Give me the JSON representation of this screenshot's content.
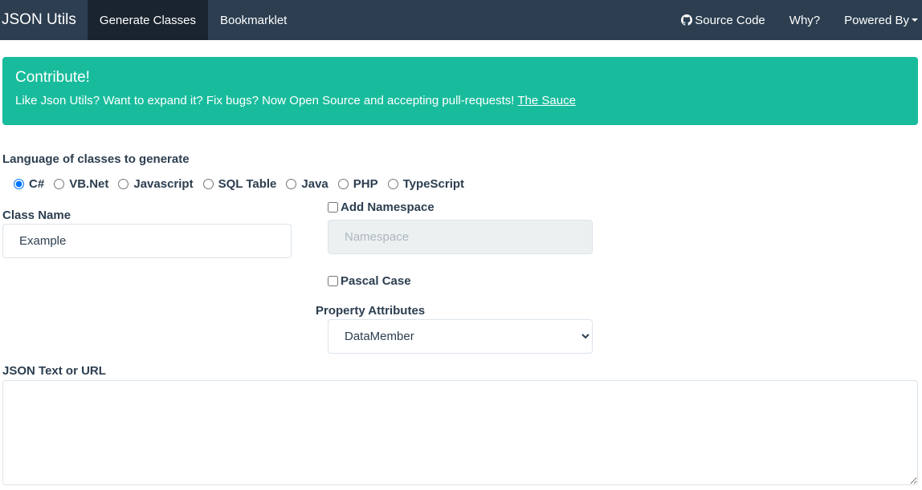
{
  "nav": {
    "brand": "JSON Utils",
    "links": [
      "Generate Classes",
      "Bookmarklet"
    ],
    "right": {
      "source": "Source Code",
      "why": "Why?",
      "powered": "Powered By"
    }
  },
  "alert": {
    "title": "Contribute!",
    "text": "Like Json Utils? Want to expand it? Fix bugs? Now Open Source and accepting pull-requests!",
    "link": "The Sauce"
  },
  "form": {
    "language_label": "Language of classes to generate",
    "languages": [
      "C#",
      "VB.Net",
      "Javascript",
      "SQL Table",
      "Java",
      "PHP",
      "TypeScript"
    ],
    "selected_language": "C#",
    "class_name_label": "Class Name",
    "class_name_value": "Example",
    "add_namespace_label": "Add Namespace",
    "namespace_placeholder": "Namespace",
    "pascal_case_label": "Pascal Case",
    "property_attributes_label": "Property Attributes",
    "property_attributes_value": "DataMember",
    "json_label": "JSON Text or URL",
    "json_value": ""
  }
}
